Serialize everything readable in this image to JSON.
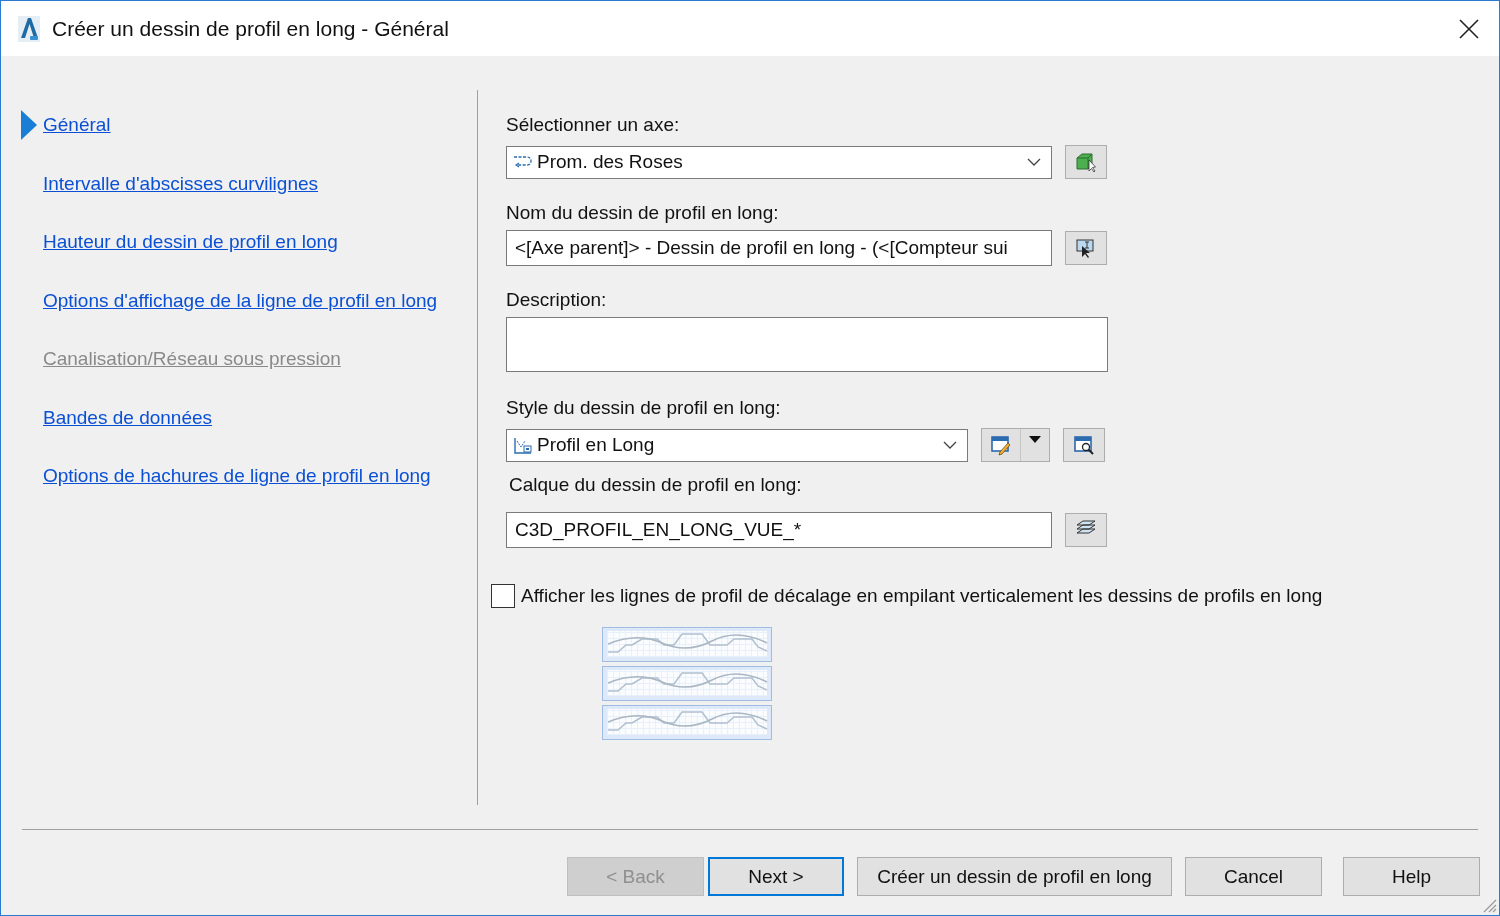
{
  "window": {
    "title": "Créer un dessin de profil en long - Général"
  },
  "nav": [
    {
      "label": "Général",
      "selected": true,
      "disabled": false
    },
    {
      "label": "Intervalle d'abscisses curvilignes",
      "selected": false,
      "disabled": false
    },
    {
      "label": "Hauteur du dessin de profil en long",
      "selected": false,
      "disabled": false
    },
    {
      "label": "Options d'affichage de la ligne de profil en long",
      "selected": false,
      "disabled": false
    },
    {
      "label": "Canalisation/Réseau sous pression",
      "selected": false,
      "disabled": true
    },
    {
      "label": "Bandes de données",
      "selected": false,
      "disabled": false
    },
    {
      "label": "Options de hachures de ligne de profil en long",
      "selected": false,
      "disabled": false
    }
  ],
  "alignment": {
    "label": "Sélectionner un axe:",
    "value": "Prom. des Roses"
  },
  "name": {
    "label": "Nom du dessin de profil en long:",
    "value": "<[Axe parent]> - Dessin de profil en long - (<[Compteur sui"
  },
  "description": {
    "label": "Description:"
  },
  "style": {
    "label": "Style du dessin de profil en long:",
    "value": "Profil en Long"
  },
  "layer": {
    "label": "Calque du dessin de profil en long:",
    "value": "C3D_PROFIL_EN_LONG_VUE_*"
  },
  "stack_option": {
    "label": "Afficher les lignes de profil de décalage en empilant verticalement les dessins de profils en long",
    "checked": false
  },
  "buttons": [
    {
      "label": "< Back",
      "disabled": true,
      "default": false
    },
    {
      "label": "Next >",
      "disabled": false,
      "default": true
    },
    {
      "label": "Créer un dessin de profil en long",
      "disabled": false,
      "default": false
    },
    {
      "label": "Cancel",
      "disabled": false,
      "default": false
    },
    {
      "label": "Help",
      "disabled": false,
      "default": false
    }
  ]
}
